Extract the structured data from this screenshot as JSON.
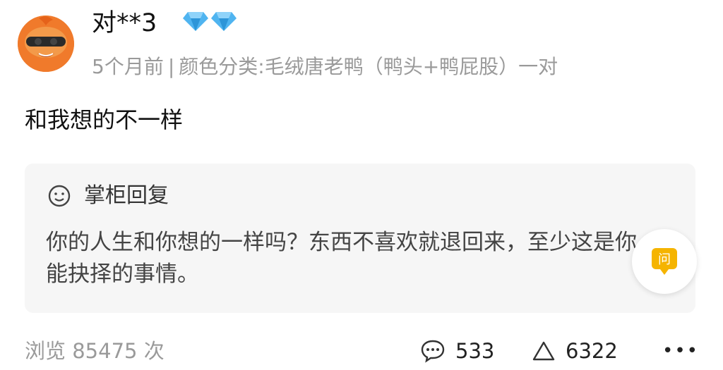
{
  "user": {
    "name": "对**3",
    "badge_icon": "diamond-icon",
    "badge_count": 2,
    "time": "5个月前",
    "separator": "|",
    "sku": "颜色分类:毛绒唐老鸭（鸭头+鸭屁股）一对"
  },
  "comment": {
    "text": "和我想的不一样"
  },
  "reply": {
    "icon": "smile-icon",
    "title": "掌柜回复",
    "body": "你的人生和你想的一样吗？东西不喜欢就退回来，至少这是你能抉择的事情。"
  },
  "ask": {
    "label": "问",
    "icon": "ask-bubble-icon"
  },
  "footer": {
    "views": "浏览 85475 次",
    "comments": "533",
    "likes": "6322",
    "more": "•••"
  },
  "colors": {
    "text_primary": "#111111",
    "text_secondary": "#9a9a9a",
    "reply_bg": "#f6f6f6",
    "diamond": "#4fb4f0",
    "ask_accent": "#f5b400",
    "avatar_orange": "#f07a2b"
  }
}
